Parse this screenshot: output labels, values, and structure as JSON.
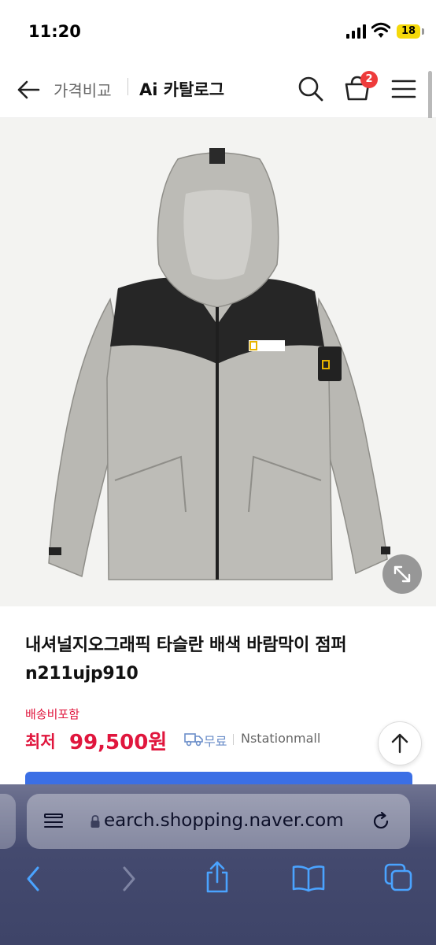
{
  "status": {
    "time": "11:20",
    "battery": "18"
  },
  "header": {
    "compare_label": "가격비교",
    "catalog_label": "Ai 카탈로그",
    "cart_count": "2"
  },
  "product": {
    "title": "내셔널지오그래픽 타슬란 배색 바람막이 점퍼 n211ujp910",
    "shipping_note": "배송비포함",
    "price_prefix": "최저",
    "price": "99,500원",
    "shipping": "무료",
    "seller": "Nstationmall"
  },
  "browser": {
    "address": "earch.shopping.naver.com"
  },
  "colors": {
    "price_red": "#e0163d",
    "badge_red": "#ee3b3b",
    "accent_blue": "#3b6fe5",
    "link_blue": "#4aa3ff"
  },
  "icons": [
    "back-arrow-icon",
    "search-icon",
    "cart-icon",
    "menu-icon",
    "zoom-expand-icon",
    "truck-icon",
    "arrow-up-icon",
    "lock-icon",
    "reload-icon",
    "share-icon",
    "bookmarks-icon",
    "tabs-icon"
  ]
}
